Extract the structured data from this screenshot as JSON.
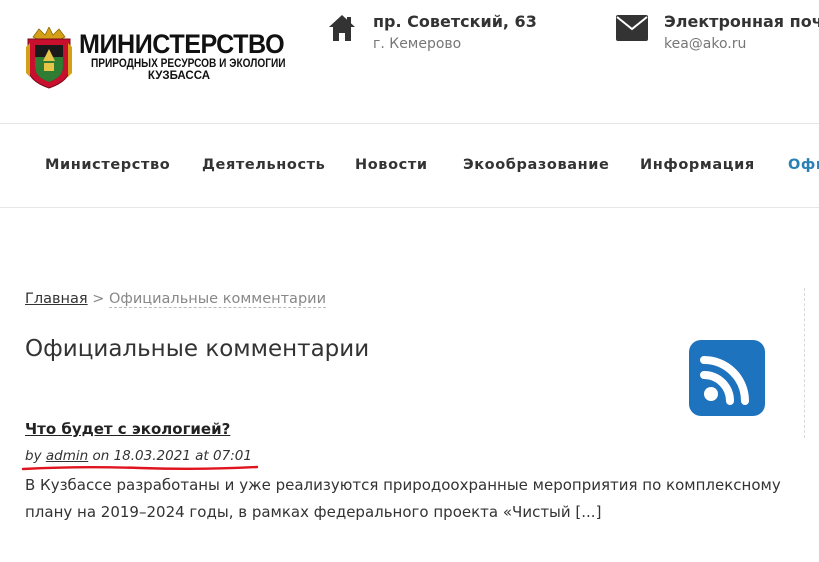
{
  "logo": {
    "line1": "МИНИСТЕРСТВО",
    "line2": "ПРИРОДНЫХ РЕСУРСОВ И ЭКОЛОГИИ",
    "line3": "КУЗБАССА",
    "emblem_icon": "coat-of-arms-icon"
  },
  "contacts": [
    {
      "icon": "home-icon",
      "title": "пр. Советский, 63",
      "subtitle": "г. Кемерово"
    },
    {
      "icon": "envelope-icon",
      "title": "Электронная почта",
      "subtitle": "kea@ako.ru"
    }
  ],
  "nav": {
    "items": [
      "Министерство",
      "Деятельность",
      "Новости",
      "Экообразование",
      "Информация",
      "Офи"
    ],
    "active_index": 5,
    "active_color": "#2a7fb5"
  },
  "breadcrumb": {
    "home": "Главная",
    "separator": ">",
    "current": "Официальные комментарии"
  },
  "page": {
    "title": "Официальные комментарии",
    "rss_icon": "rss-icon",
    "rss_color": "#1e73be"
  },
  "post": {
    "title": "Что будет с экологией?",
    "meta_by": "by",
    "author": "admin",
    "meta_on": "on 18.03.2021 at 07:01",
    "excerpt": "В Кузбассе разработаны и уже реализуются природоохранные мероприятия по комплексному плану на 2019–2024 годы, в рамках федерального проекта «Чистый [...]",
    "annotation_color": "#e0141e"
  }
}
